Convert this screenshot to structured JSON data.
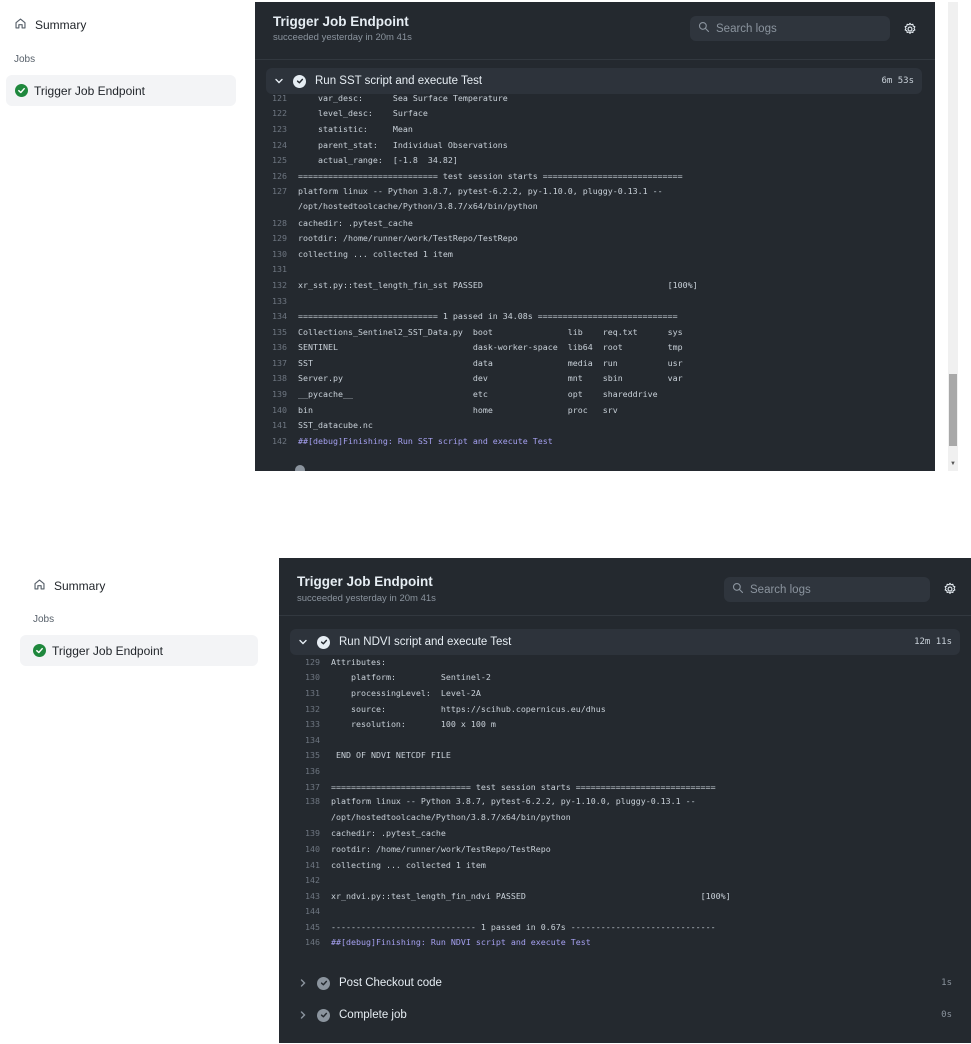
{
  "screens": [
    {
      "sidebar": {
        "summary_label": "Summary",
        "jobs_heading": "Jobs",
        "job_label": "Trigger Job Endpoint"
      },
      "panel": {
        "title": "Trigger Job Endpoint",
        "subtitle": "succeeded yesterday in 20m 41s",
        "search_placeholder": "Search logs",
        "step": {
          "title": "Run SST script and execute Test",
          "duration": "6m 53s"
        },
        "log": [
          {
            "n": "121",
            "t": "    var_desc:      Sea Surface Temperature"
          },
          {
            "n": "122",
            "t": "    level_desc:    Surface"
          },
          {
            "n": "123",
            "t": "    statistic:     Mean"
          },
          {
            "n": "124",
            "t": "    parent_stat:   Individual Observations"
          },
          {
            "n": "125",
            "t": "    actual_range:  [-1.8  34.82]"
          },
          {
            "n": "126",
            "t": "============================ test session starts ============================"
          },
          {
            "n": "127",
            "t": "platform linux -- Python 3.8.7, pytest-6.2.2, py-1.10.0, pluggy-0.13.1 --\n/opt/hostedtoolcache/Python/3.8.7/x64/bin/python",
            "wrap": true
          },
          {
            "n": "128",
            "t": "cachedir: .pytest_cache"
          },
          {
            "n": "129",
            "t": "rootdir: /home/runner/work/TestRepo/TestRepo"
          },
          {
            "n": "130",
            "t": "collecting ... collected 1 item"
          },
          {
            "n": "131",
            "t": ""
          },
          {
            "n": "132",
            "t": "xr_sst.py::test_length_fin_sst PASSED                                     [100%]"
          },
          {
            "n": "133",
            "t": ""
          },
          {
            "n": "134",
            "t": "============================ 1 passed in 34.08s ============================"
          },
          {
            "n": "135",
            "t": "Collections_Sentinel2_SST_Data.py  boot               lib    req.txt      sys"
          },
          {
            "n": "136",
            "t": "SENTINEL                           dask-worker-space  lib64  root         tmp"
          },
          {
            "n": "137",
            "t": "SST                                data               media  run          usr"
          },
          {
            "n": "138",
            "t": "Server.py                          dev                mnt    sbin         var"
          },
          {
            "n": "139",
            "t": "__pycache__                        etc                opt    shareddrive"
          },
          {
            "n": "140",
            "t": "bin                                home               proc   srv"
          },
          {
            "n": "141",
            "t": "SST_datacube.nc"
          },
          {
            "n": "142",
            "t": "##[debug]Finishing: Run SST script and execute Test",
            "debug": true
          }
        ]
      }
    },
    {
      "sidebar": {
        "summary_label": "Summary",
        "jobs_heading": "Jobs",
        "job_label": "Trigger Job Endpoint"
      },
      "panel": {
        "title": "Trigger Job Endpoint",
        "subtitle": "succeeded yesterday in 20m 41s",
        "search_placeholder": "Search logs",
        "step": {
          "title": "Run NDVI script and execute Test",
          "duration": "12m 11s"
        },
        "log": [
          {
            "n": "129",
            "t": "Attributes:"
          },
          {
            "n": "130",
            "t": "    platform:         Sentinel-2"
          },
          {
            "n": "131",
            "t": "    processingLevel:  Level-2A"
          },
          {
            "n": "132",
            "t": "    source:           https://scihub.copernicus.eu/dhus"
          },
          {
            "n": "133",
            "t": "    resolution:       100 x 100 m"
          },
          {
            "n": "134",
            "t": ""
          },
          {
            "n": "135",
            "t": " END OF NDVI NETCDF FILE"
          },
          {
            "n": "136",
            "t": ""
          },
          {
            "n": "137",
            "t": "============================ test session starts ============================"
          },
          {
            "n": "138",
            "t": "platform linux -- Python 3.8.7, pytest-6.2.2, py-1.10.0, pluggy-0.13.1 --\n/opt/hostedtoolcache/Python/3.8.7/x64/bin/python",
            "wrap": true
          },
          {
            "n": "139",
            "t": "cachedir: .pytest_cache"
          },
          {
            "n": "140",
            "t": "rootdir: /home/runner/work/TestRepo/TestRepo"
          },
          {
            "n": "141",
            "t": "collecting ... collected 1 item"
          },
          {
            "n": "142",
            "t": ""
          },
          {
            "n": "143",
            "t": "xr_ndvi.py::test_length_fin_ndvi PASSED                                   [100%]"
          },
          {
            "n": "144",
            "t": ""
          },
          {
            "n": "145",
            "t": "----------------------------- 1 passed in 0.67s -----------------------------"
          },
          {
            "n": "146",
            "t": "##[debug]Finishing: Run NDVI script and execute Test",
            "debug": true
          }
        ],
        "other_steps": [
          {
            "title": "Post Checkout code",
            "duration": "1s"
          },
          {
            "title": "Complete job",
            "duration": "0s"
          }
        ]
      }
    }
  ]
}
